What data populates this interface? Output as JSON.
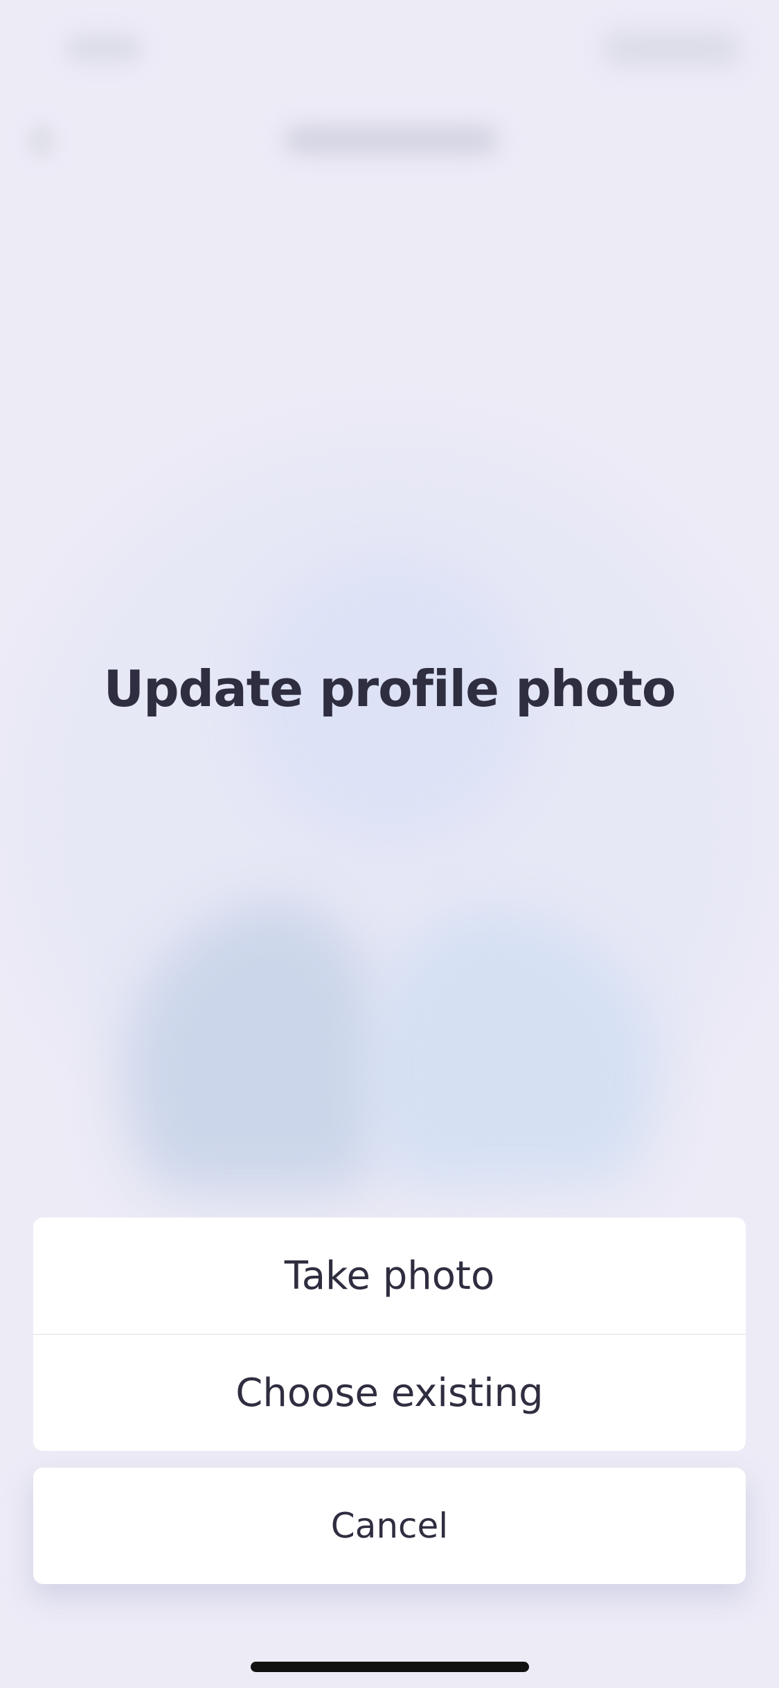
{
  "sheet": {
    "title": "Update profile photo",
    "actions": [
      {
        "label": "Take photo"
      },
      {
        "label": "Choose existing"
      }
    ],
    "cancel_label": "Cancel"
  },
  "colors": {
    "background": "#ecebf6",
    "sheet_surface": "#ffffff",
    "text": "#2f2e40",
    "divider": "#e1e0e8",
    "home_indicator": "#111111"
  },
  "icons": {
    "blurred_background": "avatar-placeholder-icon"
  }
}
